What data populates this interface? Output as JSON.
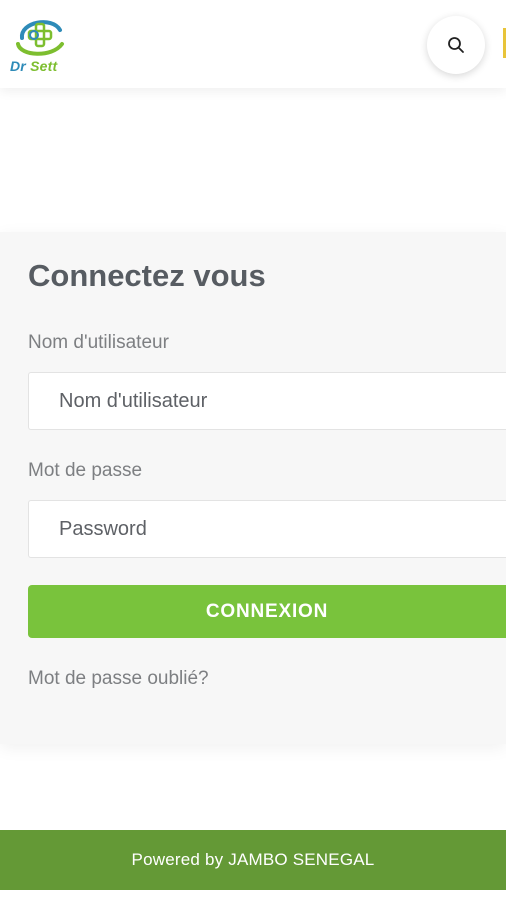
{
  "header": {
    "logo_text_dr": "Dr",
    "logo_text_sett": "Sett",
    "search_icon": "search-icon",
    "colors": {
      "logo_blue": "#2e8bb8",
      "logo_green": "#7dbe2f",
      "edge_accent": "#e8c43a"
    }
  },
  "login": {
    "title": "Connectez vous",
    "username_label": "Nom d'utilisateur",
    "username_placeholder": "Nom d'utilisateur",
    "username_value": "",
    "password_label": "Mot de passe",
    "password_placeholder": "Password",
    "password_value": "",
    "submit_label": "CONNEXION",
    "forgot_label": "Mot de passe oublié?",
    "colors": {
      "button": "#79c33c"
    }
  },
  "footer": {
    "text": "Powered by JAMBO SENEGAL",
    "color": "#649936"
  }
}
